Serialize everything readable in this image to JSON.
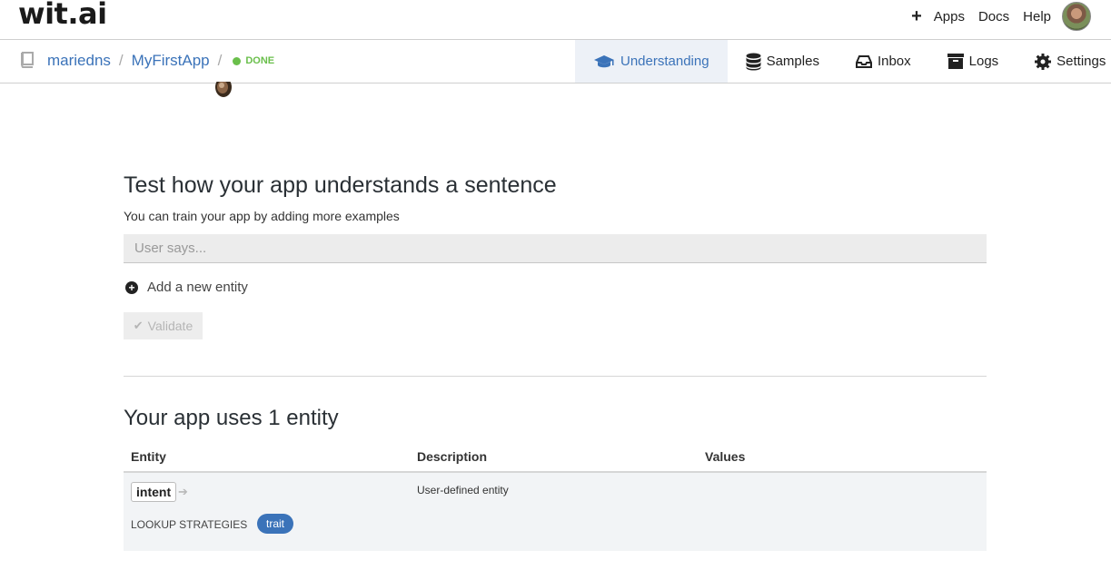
{
  "brand": {
    "logo_text": "wit.ai"
  },
  "topnav": {
    "apps_label": "Apps",
    "docs_label": "Docs",
    "help_label": "Help"
  },
  "breadcrumb": {
    "user": "mariedns",
    "separator": "/",
    "app": "MyFirstApp",
    "status": "DONE"
  },
  "tabs": [
    {
      "label": "Understanding",
      "icon": "graduation-cap-icon",
      "active": true
    },
    {
      "label": "Samples",
      "icon": "database-icon",
      "active": false
    },
    {
      "label": "Inbox",
      "icon": "inbox-icon",
      "active": false
    },
    {
      "label": "Logs",
      "icon": "archive-icon",
      "active": false
    },
    {
      "label": "Settings",
      "icon": "gear-icon",
      "active": false
    }
  ],
  "test": {
    "title": "Test how your app understands a sentence",
    "subtitle": "You can train your app by adding more examples",
    "input_placeholder": "User says...",
    "input_value": "",
    "add_entity_label": "Add a new entity",
    "validate_label": "Validate"
  },
  "entities": {
    "title": "Your app uses 1 entity",
    "columns": [
      "Entity",
      "Description",
      "Values"
    ],
    "rows": [
      {
        "name": "intent",
        "description": "User-defined entity",
        "values": "",
        "lookup_label": "LOOKUP STRATEGIES",
        "lookup_strategy": "trait"
      }
    ]
  },
  "colors": {
    "accent": "#3b73b9",
    "status_done": "#6abf4b",
    "active_tab_bg": "#edf1f7"
  }
}
